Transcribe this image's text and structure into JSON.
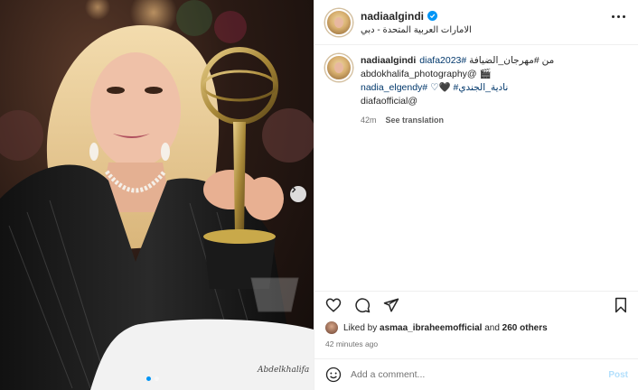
{
  "photo": {
    "watermark": "Abdelkhalifa",
    "carousel_slides": 2,
    "active_slide": 1
  },
  "post": {
    "username": "nadiaalgindi",
    "verified": true,
    "location": "الامارات العربية المتحدة - دبي",
    "caption": {
      "username": "nadiaalgindi",
      "line1_tag": "diafa2023#",
      "line1_text": " من #مهرجان_الضيافة",
      "line2": "abdokhalifa_photography@ 🎬",
      "line3_tags": "nadia_elgendy# ♡🖤 #نادية_الجندي",
      "line4": "diafaofficial@"
    },
    "time_short": "42m",
    "see_translation": "See translation",
    "liked_by_prefix": "Liked by",
    "liked_by_user": "asmaa_ibraheemofficial",
    "liked_by_and": "and",
    "liked_by_others": "260 others",
    "time_ago": "42 minutes ago",
    "comment_placeholder": "Add a comment...",
    "post_button": "Post"
  },
  "colors": {
    "verified": "#0095f6",
    "link": "#00376b",
    "muted": "#737373",
    "post_disabled": "#b2dffc"
  }
}
